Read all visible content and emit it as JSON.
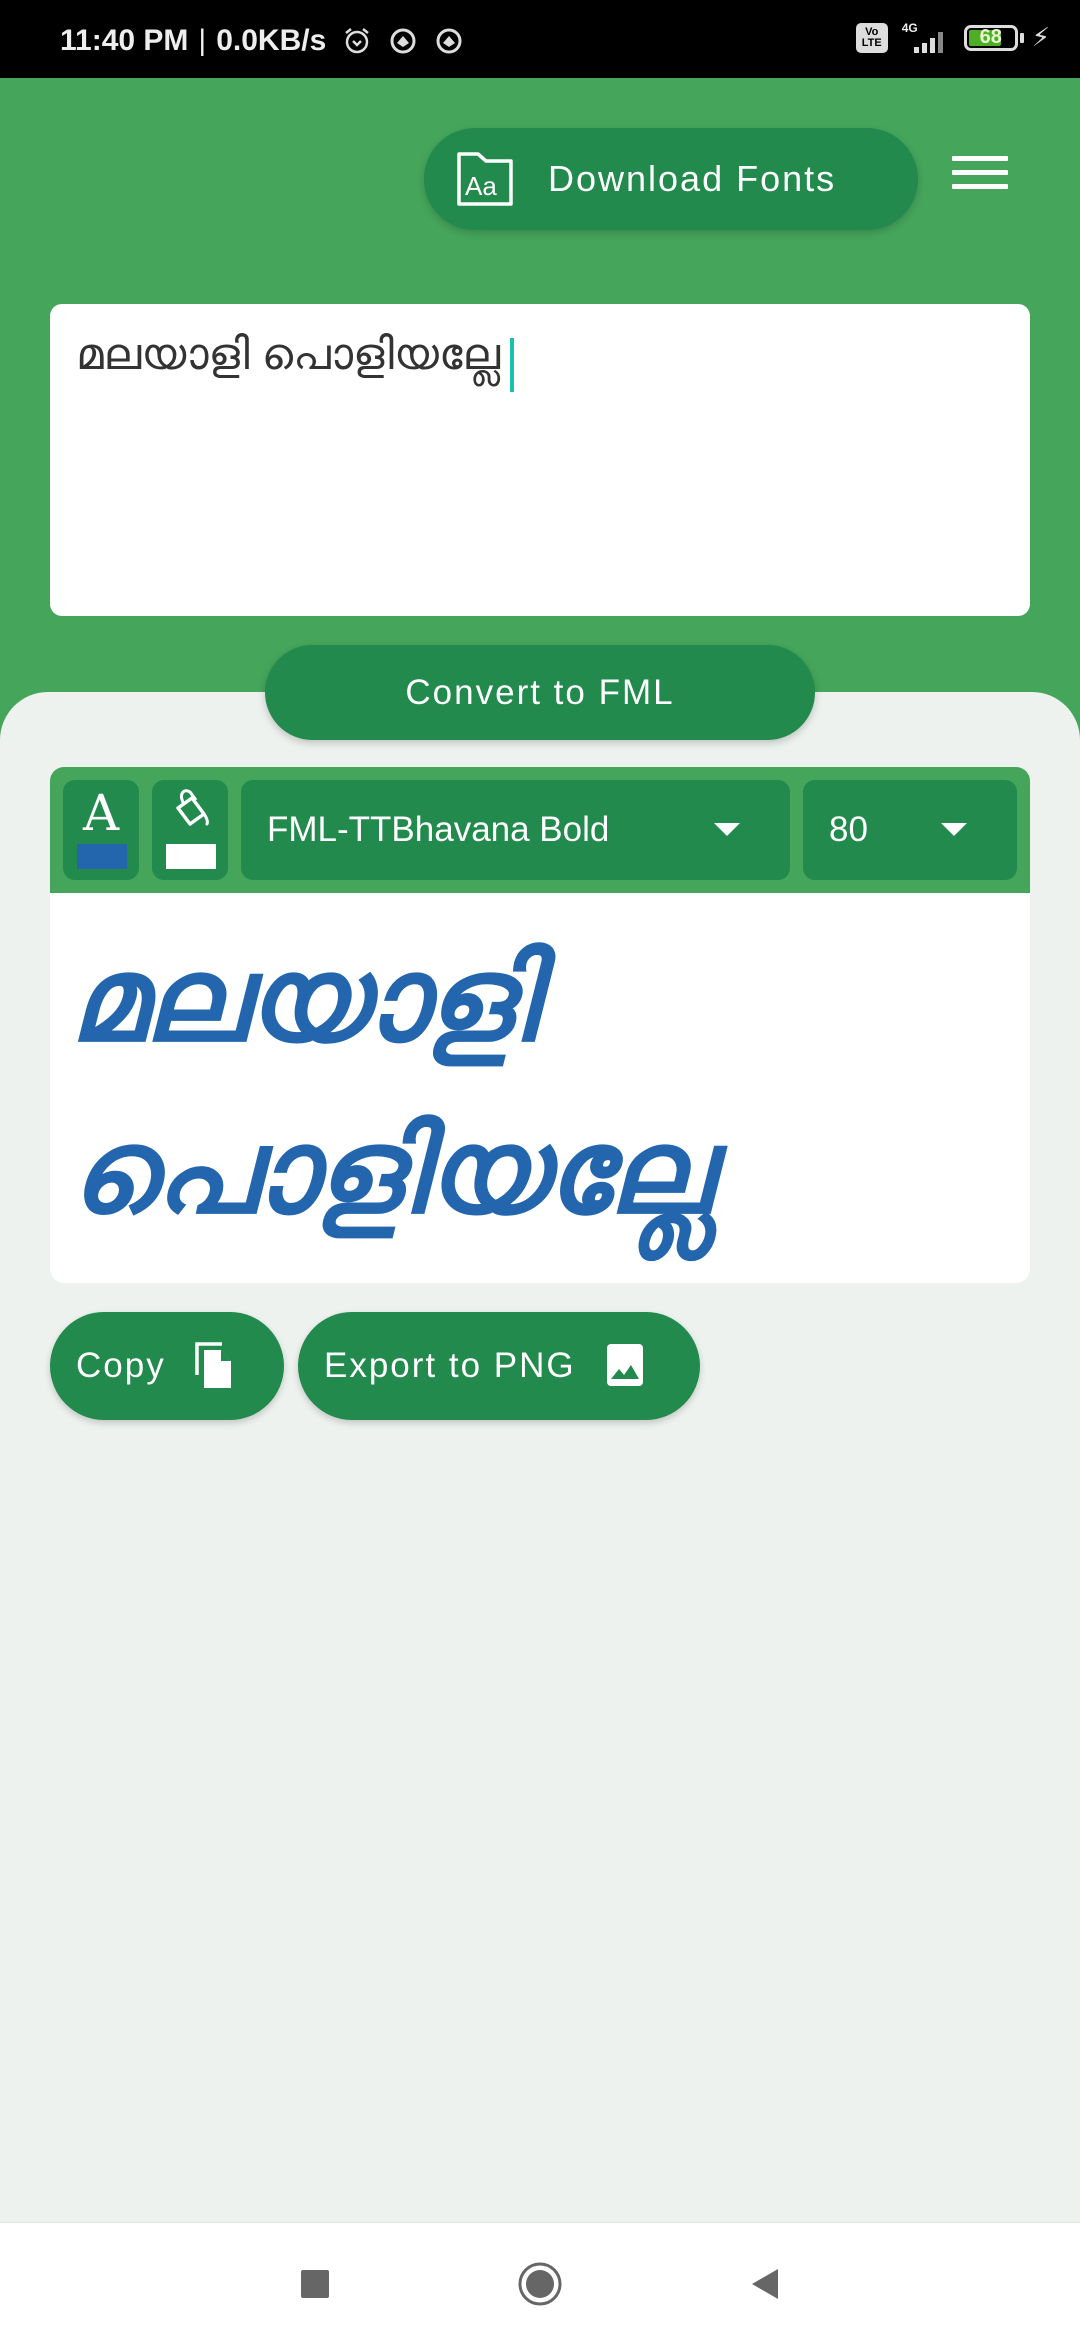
{
  "status_bar": {
    "time": "11:40 PM",
    "net_speed": "0.0KB/s",
    "icons": [
      "alarm-icon",
      "vpn-icon",
      "vpn-icon"
    ],
    "volte": "Vo LTE",
    "network_type": "4G",
    "battery_percent": "68"
  },
  "header": {
    "download_fonts_label": "Download Fonts",
    "menu_icon": "hamburger-menu-icon"
  },
  "input": {
    "text": "മലയാളി പൊളിയല്ലേ"
  },
  "convert_button_label": "Convert to FML",
  "toolbar": {
    "text_color": "#2466ad",
    "background_color": "#ffffff",
    "font_selected": "FML-TTBhavana Bold",
    "size_selected": "80"
  },
  "preview": {
    "text": "മലയാളി പൊളിയല്ലേ",
    "text_color": "#2466ad"
  },
  "actions": {
    "copy_label": "Copy",
    "export_label": "Export to PNG"
  },
  "colors": {
    "header_green": "#45a55b",
    "button_green": "#218a4c",
    "panel_bg": "#edf2ee",
    "caret": "#1bc0b5"
  }
}
